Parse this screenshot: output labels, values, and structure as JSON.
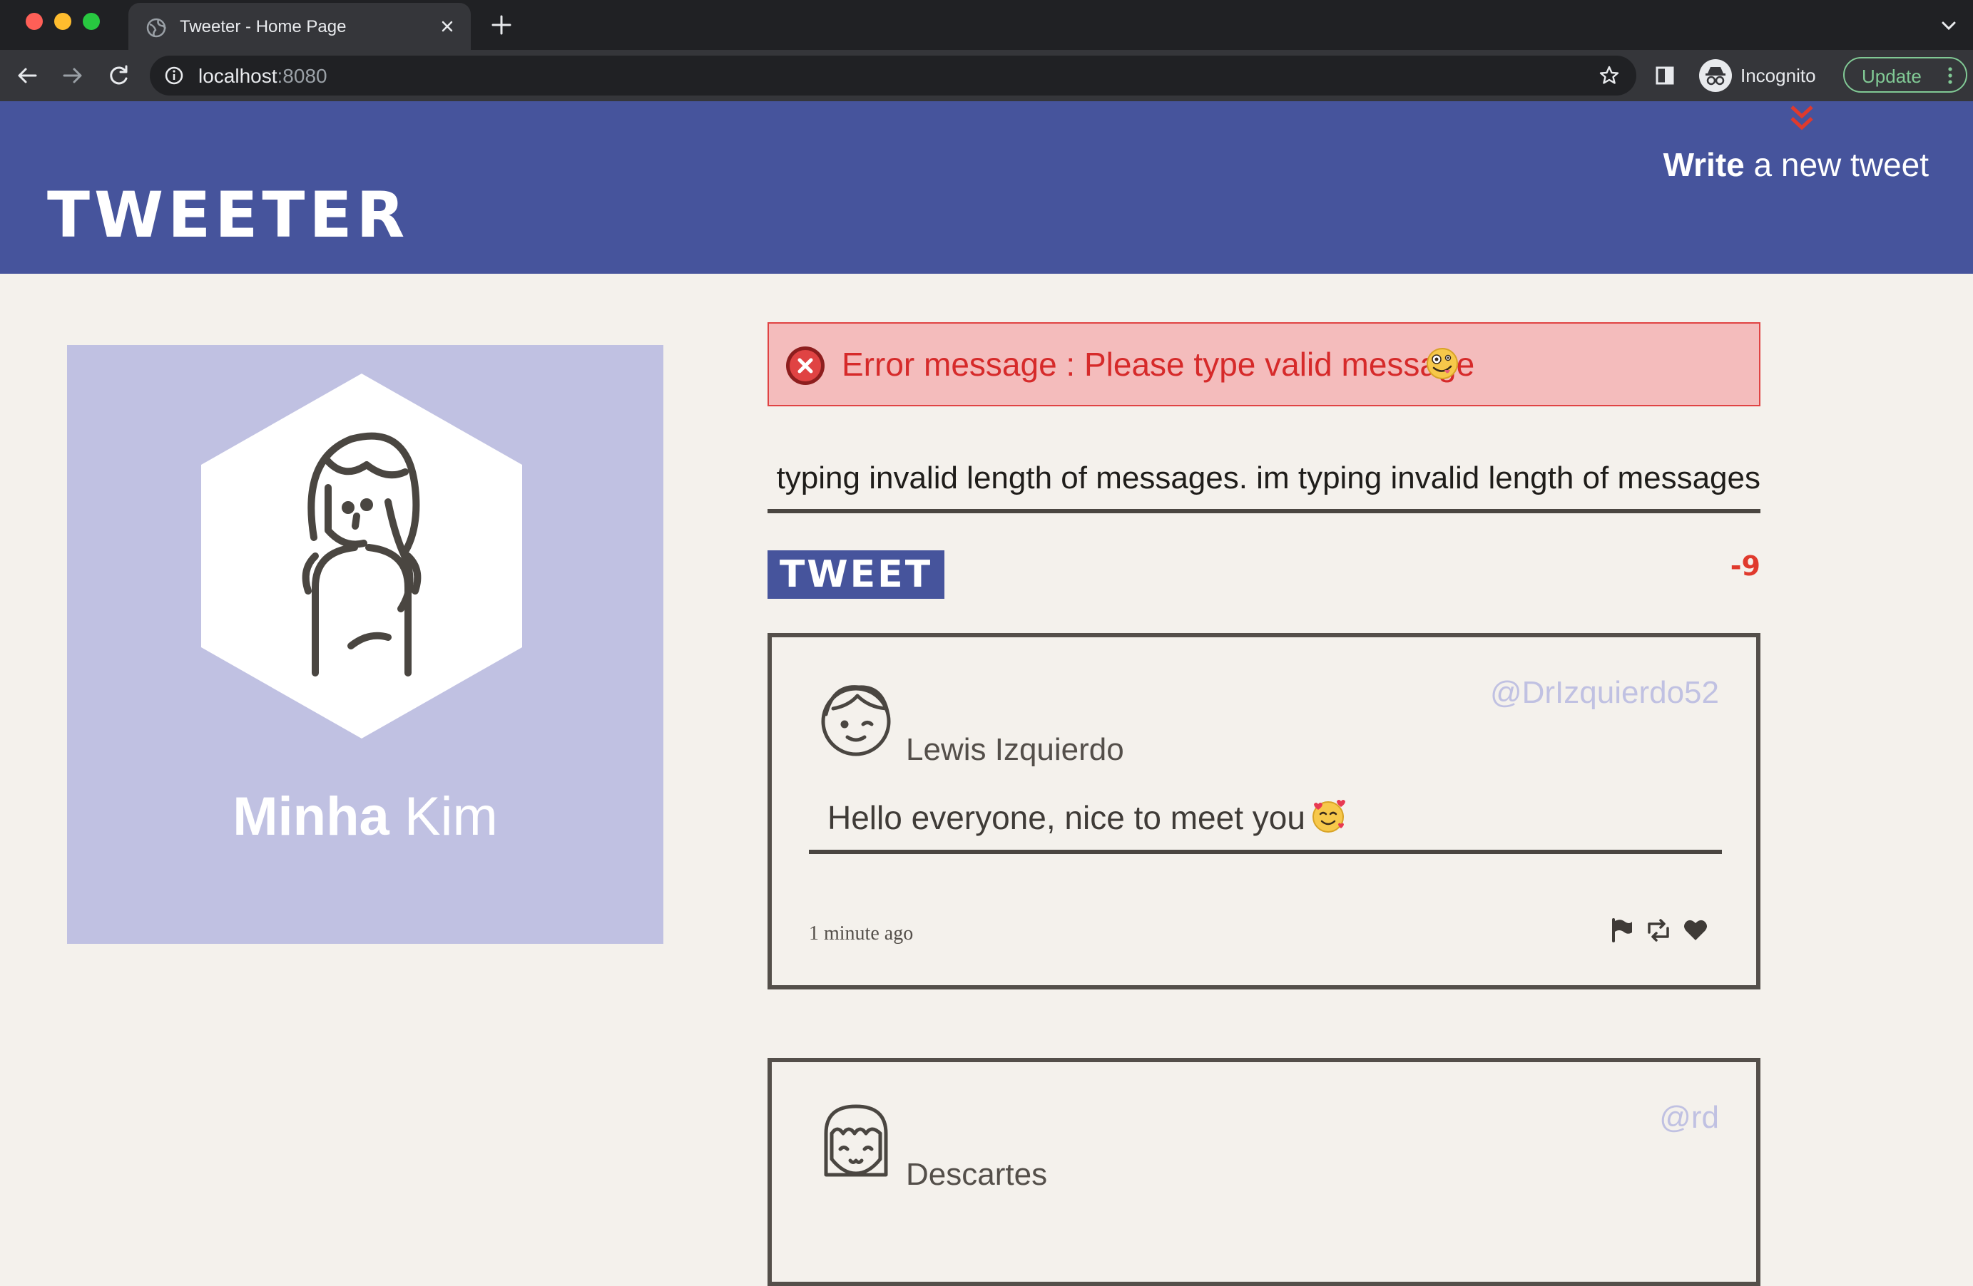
{
  "browser": {
    "tab_title": "Tweeter - Home Page",
    "url_host": "localhost",
    "url_port": ":8080",
    "profile_label": "Incognito",
    "update_label": "Update"
  },
  "header": {
    "logo": "TWEETER",
    "write_strong": "Write",
    "write_rest": " a new tweet"
  },
  "profile": {
    "first_name": "Minha",
    "last_name": " Kim"
  },
  "compose": {
    "error_text": "Error message : Please type valid message",
    "input_value": "im typing invalid length of messages. im typing invalid length of messages",
    "tweet_button": "TWEET",
    "char_counter": "-9"
  },
  "tweets": [
    {
      "name": "Lewis Izquierdo",
      "handle": "@DrIzquierdo52",
      "text": "Hello everyone, nice to meet you",
      "time": "1 minute ago"
    },
    {
      "name": "Descartes",
      "handle": "@rd"
    }
  ],
  "colors": {
    "brand": "#46549c",
    "profile_bg": "#c0c1e2",
    "page_bg": "#f4f1ec",
    "error_bg": "#f4bcbc",
    "error_text": "#d62a2a",
    "counter_negative": "#e03a2d"
  }
}
